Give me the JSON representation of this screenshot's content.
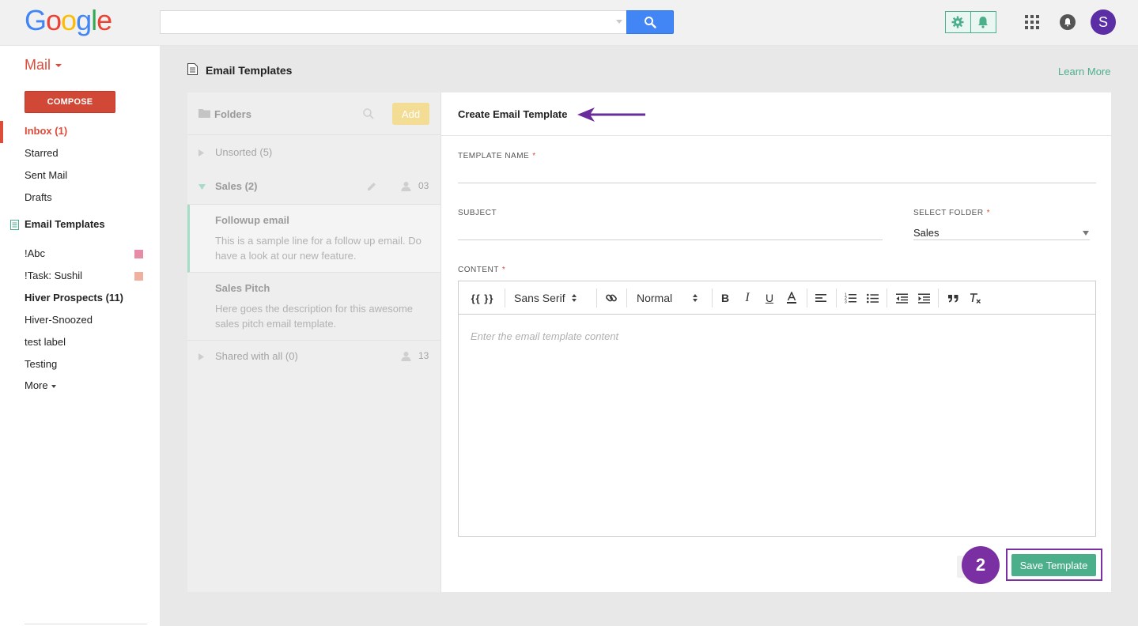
{
  "google_logo": {
    "letters": [
      {
        "char": "G",
        "color": "#4285f4"
      },
      {
        "char": "o",
        "color": "#ea4335"
      },
      {
        "char": "o",
        "color": "#fbbc05"
      },
      {
        "char": "g",
        "color": "#4285f4"
      },
      {
        "char": "l",
        "color": "#34a853"
      },
      {
        "char": "e",
        "color": "#ea4335"
      }
    ]
  },
  "header": {
    "search_value": "",
    "search_icon": "search-icon",
    "hiver_icons": [
      "gear-icon",
      "bell-icon"
    ],
    "avatar_initial": "S",
    "avatar_color": "#5b2ea6"
  },
  "sidebar": {
    "mail_label": "Mail",
    "compose_label": "COMPOSE",
    "nav": {
      "inbox": "Inbox (1)",
      "starred": "Starred",
      "sent": "Sent Mail",
      "drafts": "Drafts",
      "email_templates": "Email Templates"
    },
    "labels": {
      "abc": "!Abc",
      "task_sushil": "!Task: Sushil",
      "hiver_prospects": "Hiver Prospects (11)",
      "hiver_snoozed": "Hiver-Snoozed",
      "test_label": "test label",
      "testing": "Testing",
      "more": "More"
    },
    "label_colors": {
      "abc": "#e88ba6",
      "task_sushil": "#f0b0a0"
    }
  },
  "main": {
    "page_title": "Email Templates",
    "learn_more": "Learn More",
    "folders_panel": {
      "title": "Folders",
      "add_label": "Add",
      "unsorted": "Unsorted (5)",
      "sales": "Sales (2)",
      "sales_count": "03",
      "templates": [
        {
          "name": "Followup email",
          "desc": "This is a sample line for a follow up email. Do have a look at our new feature."
        },
        {
          "name": "Sales Pitch",
          "desc": "Here goes the description for this awesome sales pitch email template."
        }
      ],
      "shared": "Shared with all (0)",
      "shared_count": "13"
    },
    "create_panel": {
      "title": "Create Email Template",
      "template_name_label": "TEMPLATE NAME",
      "template_name_value": "",
      "subject_label": "SUBJECT",
      "subject_value": "",
      "select_folder_label": "SELECT FOLDER",
      "select_folder_value": "Sales",
      "content_label": "CONTENT",
      "required_mark": "*",
      "toolbar": {
        "placeholder_btn": "{{ }}",
        "font": "Sans Serif",
        "size": "Normal"
      },
      "content_placeholder": "Enter the email template content",
      "step_number": "2",
      "save_label": "Save Template"
    }
  },
  "colors": {
    "accent_green": "#4caf8c",
    "annotation_purple": "#7a2fa3",
    "gmail_red": "#dd4b39",
    "search_blue": "#4285f4"
  }
}
